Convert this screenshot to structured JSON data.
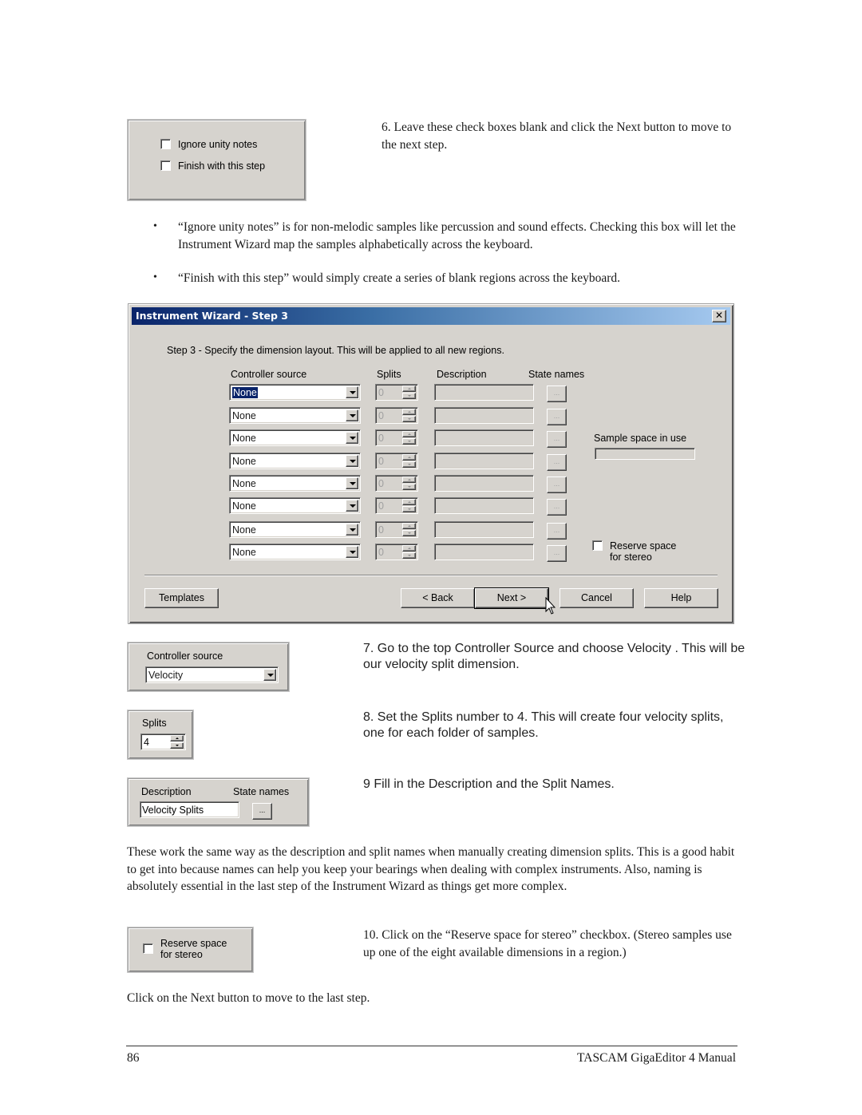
{
  "snippet_step6": {
    "checkboxes": [
      {
        "label": "Ignore unity notes",
        "checked": false
      },
      {
        "label": "Finish with this step",
        "checked": false
      }
    ]
  },
  "step6_text": "6. Leave these check boxes blank and click the Next button to move to the next step.",
  "bullets": [
    "“Ignore unity notes” is for non-melodic samples like percussion and sound effects.  Checking this box will let the Instrument Wizard map the samples alphabetically across the keyboard.",
    "“Finish with this step” would simply create a series of blank regions across the keyboard."
  ],
  "dialog": {
    "title": "Instrument Wizard - Step 3",
    "close_glyph": "✕",
    "instruction": "Step 3 - Specify the dimension layout.  This will be applied to all new regions.",
    "columns": {
      "controller_source": "Controller source",
      "splits": "Splits",
      "description": "Description",
      "state_names": "State names"
    },
    "rows": [
      {
        "controller": "None",
        "splits": "0",
        "description": "",
        "state_button": "...",
        "selected": true
      },
      {
        "controller": "None",
        "splits": "0",
        "description": "",
        "state_button": "..."
      },
      {
        "controller": "None",
        "splits": "0",
        "description": "",
        "state_button": "..."
      },
      {
        "controller": "None",
        "splits": "0",
        "description": "",
        "state_button": "..."
      },
      {
        "controller": "None",
        "splits": "0",
        "description": "",
        "state_button": "..."
      },
      {
        "controller": "None",
        "splits": "0",
        "description": "",
        "state_button": "..."
      },
      {
        "controller": "None",
        "splits": "0",
        "description": "",
        "state_button": "..."
      },
      {
        "controller": "None",
        "splits": "0",
        "description": "",
        "state_button": "..."
      }
    ],
    "sample_space_label": "Sample space in use",
    "reserve_stereo": {
      "line1": "Reserve space",
      "line2": "for stereo",
      "checked": false
    },
    "buttons": {
      "templates": "Templates",
      "back": "< Back",
      "next": "Next >",
      "cancel": "Cancel",
      "help": "Help"
    }
  },
  "snippet_controller": {
    "label": "Controller source",
    "value": "Velocity"
  },
  "snippet_splits": {
    "label": "Splits",
    "value": "4"
  },
  "snippet_description": {
    "desc_label": "Description",
    "state_label": "State names",
    "value": "Velocity Splits",
    "button": "..."
  },
  "step7_text": "7. Go to the top Controller Source and choose  Velocity .  This will be our velocity split dimension.",
  "step8_text": "8. Set the Splits number to 4. This will create four velocity splits, one for each folder of samples.",
  "step9_text": "9 Fill in the Description and the Split Names.",
  "paragraph": "These work the same way as the description and split names when manually creating dimension splits.  This is a good habit to get into because names can help you keep your bearings when dealing with complex instruments.  Also, naming is absolutely essential in the last step of the Instrument Wizard as things get more complex.",
  "snippet_stereo": {
    "line1": "Reserve space",
    "line2": "for stereo",
    "checked": false
  },
  "step10_text": "10. Click on the “Reserve space for stereo” checkbox.  (Stereo samples use up one of the eight available dimensions in a region.)",
  "closing_text": "Click on the Next button to move to the last step.",
  "footer": {
    "page_number": "86",
    "manual_title": "TASCAM GigaEditor 4 Manual"
  },
  "colors": {
    "title_dark": "#0a246a",
    "title_light": "#a6caf0",
    "panel": "#d6d3ce",
    "selection": "#0a246a"
  }
}
